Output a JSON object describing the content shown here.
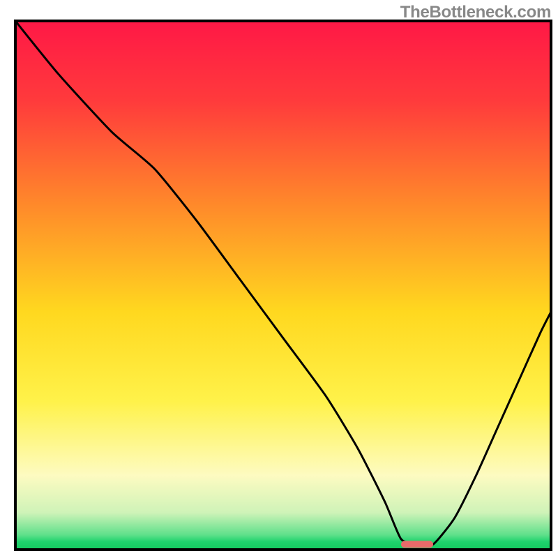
{
  "watermark": "TheBottleneck.com",
  "chart_data": {
    "type": "line",
    "title": "",
    "subtitle": "",
    "xlabel": "",
    "ylabel": "",
    "xlim": [
      0,
      100
    ],
    "ylim": [
      0,
      100
    ],
    "grid": false,
    "background": {
      "type": "vertical-gradient",
      "description": "smooth gradient from red at the top through orange, yellow to green at the bottom, with a narrow bright-green band at the very bottom",
      "stops": [
        {
          "pos": 0.0,
          "color": "#ff1846"
        },
        {
          "pos": 0.15,
          "color": "#ff3a3c"
        },
        {
          "pos": 0.35,
          "color": "#ff8a2a"
        },
        {
          "pos": 0.55,
          "color": "#ffd81f"
        },
        {
          "pos": 0.72,
          "color": "#fff24a"
        },
        {
          "pos": 0.86,
          "color": "#fdfbc1"
        },
        {
          "pos": 0.93,
          "color": "#cff3b8"
        },
        {
          "pos": 0.972,
          "color": "#5fe08b"
        },
        {
          "pos": 0.985,
          "color": "#1fd36d"
        },
        {
          "pos": 1.0,
          "color": "#14c95f"
        }
      ]
    },
    "series": [
      {
        "name": "bottleneck-curve",
        "description": "V-shaped curve: starts near top-left, drops with a slight bend, reaches a flat minimum near x≈72-78 at the bottom of the plot, then rises again toward the right edge",
        "x": [
          0,
          8,
          18,
          26,
          34,
          42,
          50,
          58,
          64,
          69,
          72,
          75,
          78,
          82,
          86,
          90,
          94,
          98,
          100
        ],
        "y": [
          100,
          90,
          79,
          72,
          62,
          51,
          40,
          29,
          19,
          9,
          2,
          1,
          1,
          6,
          14,
          23,
          32,
          41,
          45
        ]
      }
    ],
    "marker": {
      "description": "short reddish rounded segment at the curve's flat minimum",
      "x_start": 72,
      "x_end": 78,
      "y": 1,
      "color": "#e96a6a"
    },
    "frame": {
      "color": "#000000",
      "width": 4
    }
  }
}
